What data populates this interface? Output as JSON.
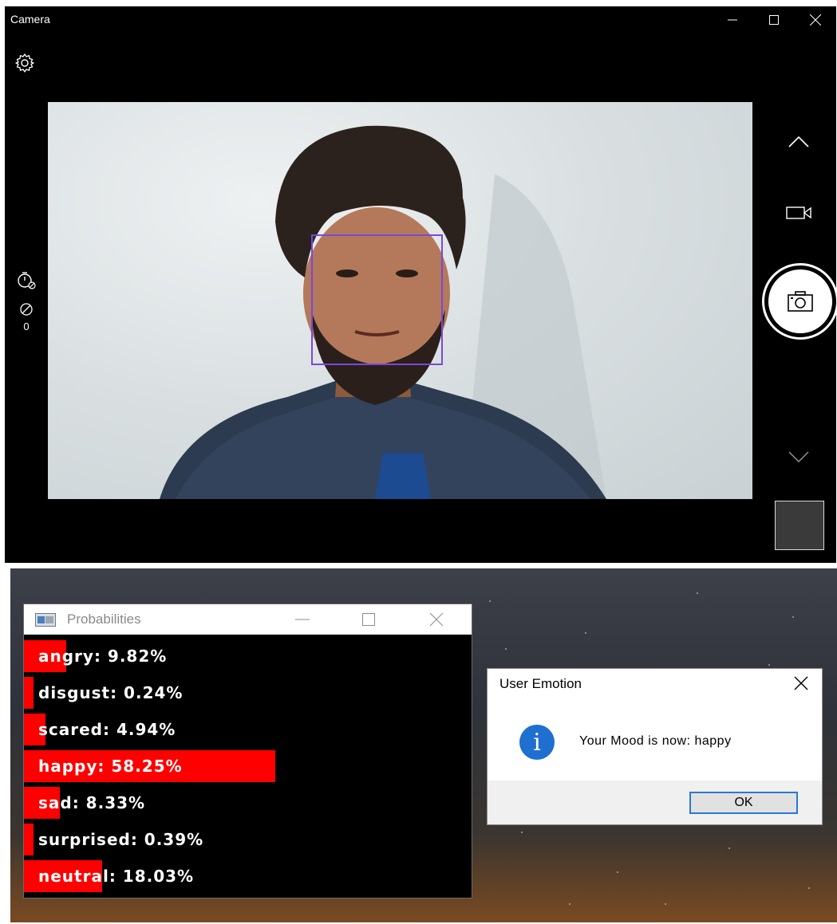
{
  "camera": {
    "title": "Camera",
    "timer_label": "0"
  },
  "probabilities": {
    "title": "Probabilities",
    "rows": [
      {
        "label": "angry: 9.82%",
        "value": 9.82
      },
      {
        "label": "disgust: 0.24%",
        "value": 0.24
      },
      {
        "label": "scared: 4.94%",
        "value": 4.94
      },
      {
        "label": "happy: 58.25%",
        "value": 58.25
      },
      {
        "label": "sad: 8.33%",
        "value": 8.33
      },
      {
        "label": "surprised: 0.39%",
        "value": 0.39
      },
      {
        "label": "neutral: 18.03%",
        "value": 18.03
      }
    ]
  },
  "dialog": {
    "title": "User Emotion",
    "message": "Your Mood is now: happy",
    "ok_label": "OK"
  },
  "colors": {
    "bar": "#ff0000",
    "face_box": "#7b48d8",
    "info": "#1e6fd0"
  }
}
